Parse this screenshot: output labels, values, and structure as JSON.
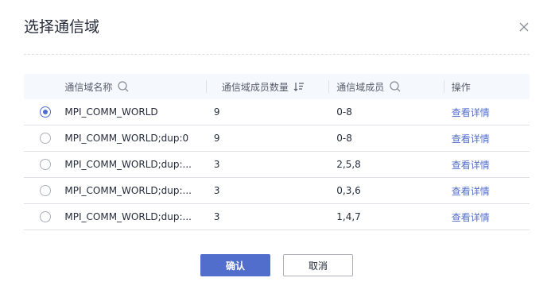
{
  "dialog": {
    "title": "选择通信域",
    "close_icon": "close-icon"
  },
  "table": {
    "headers": {
      "name": "通信域名称",
      "count": "通信域成员数量",
      "members": "通信域成员",
      "operation": "操作"
    },
    "rows": [
      {
        "selected": true,
        "name": "MPI_COMM_WORLD",
        "count": "9",
        "members": "0-8",
        "action": "查看详情"
      },
      {
        "selected": false,
        "name": "MPI_COMM_WORLD;dup:0",
        "count": "9",
        "members": "0-8",
        "action": "查看详情"
      },
      {
        "selected": false,
        "name": "MPI_COMM_WORLD;dup:...",
        "count": "3",
        "members": "2,5,8",
        "action": "查看详情"
      },
      {
        "selected": false,
        "name": "MPI_COMM_WORLD;dup:...",
        "count": "3",
        "members": "0,3,6",
        "action": "查看详情"
      },
      {
        "selected": false,
        "name": "MPI_COMM_WORLD;dup:...",
        "count": "3",
        "members": "1,4,7",
        "action": "查看详情"
      }
    ]
  },
  "footer": {
    "confirm_label": "确认",
    "cancel_label": "取消"
  },
  "colors": {
    "primary": "#526ecc",
    "header_bg": "#f5f8fc",
    "border": "#dfe1e6",
    "text": "#252b3a"
  }
}
